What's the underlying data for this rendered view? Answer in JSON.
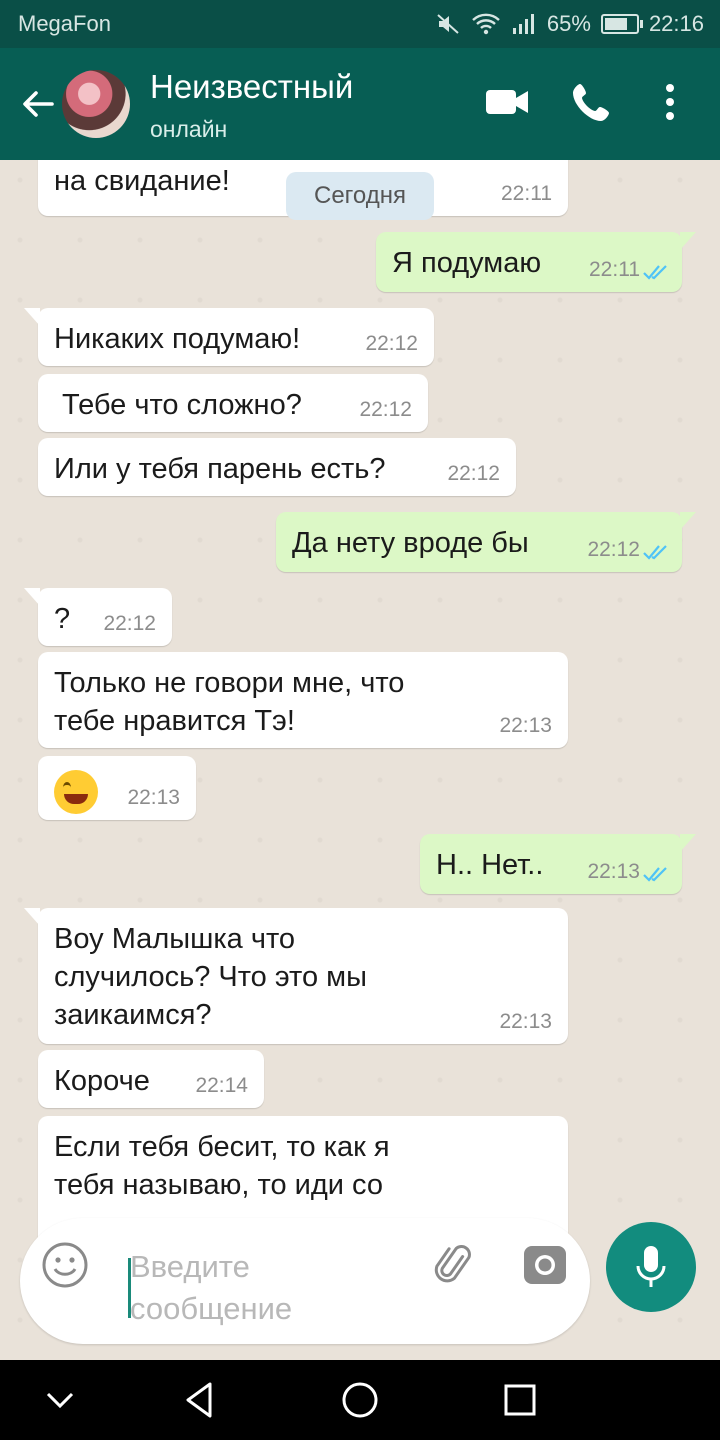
{
  "status_bar": {
    "carrier": "MegaFon",
    "battery": "65%",
    "time": "22:16"
  },
  "header": {
    "contact_name": "Неизвестный",
    "status": "онлайн"
  },
  "date_pill": "Сегодня",
  "messages": [
    {
      "dir": "in",
      "text": "на свидание!",
      "time": "22:11"
    },
    {
      "dir": "out",
      "text": "Я подумаю",
      "time": "22:11",
      "read": true
    },
    {
      "dir": "in",
      "text": "Никаких подумаю!",
      "time": "22:12"
    },
    {
      "dir": "in",
      "text": "Тебе что сложно?",
      "time": "22:12"
    },
    {
      "dir": "in",
      "text": "Или у тебя парень есть?",
      "time": "22:12"
    },
    {
      "dir": "out",
      "text": "Да нету вроде бы",
      "time": "22:12",
      "read": true
    },
    {
      "dir": "in",
      "text": "?",
      "time": "22:12"
    },
    {
      "dir": "in",
      "text_lines": [
        "Только не говори мне, что",
        "тебе нравится Тэ!"
      ],
      "time": "22:13"
    },
    {
      "dir": "in",
      "emoji": "rolling-on-floor-laughing",
      "time": "22:13"
    },
    {
      "dir": "out",
      "text": "Н.. Нет..",
      "time": "22:13",
      "read": true
    },
    {
      "dir": "in",
      "text_lines": [
        "Воу Малышка что",
        "случилось? Что это мы",
        "заикаимся?"
      ],
      "time": "22:13"
    },
    {
      "dir": "in",
      "text": "Короче",
      "time": "22:14"
    },
    {
      "dir": "in",
      "text_lines": [
        "Если тебя бесит, то как я",
        "тебя называю, то иди со"
      ]
    }
  ],
  "input": {
    "placeholder_lines": [
      "Введите",
      "сообщение"
    ]
  },
  "colors": {
    "header": "#075e54",
    "status_bar": "#0a4f47",
    "outgoing_bubble": "#dcf8c6",
    "read_ticks": "#4fc3f7",
    "mic_button": "#128c7e"
  }
}
